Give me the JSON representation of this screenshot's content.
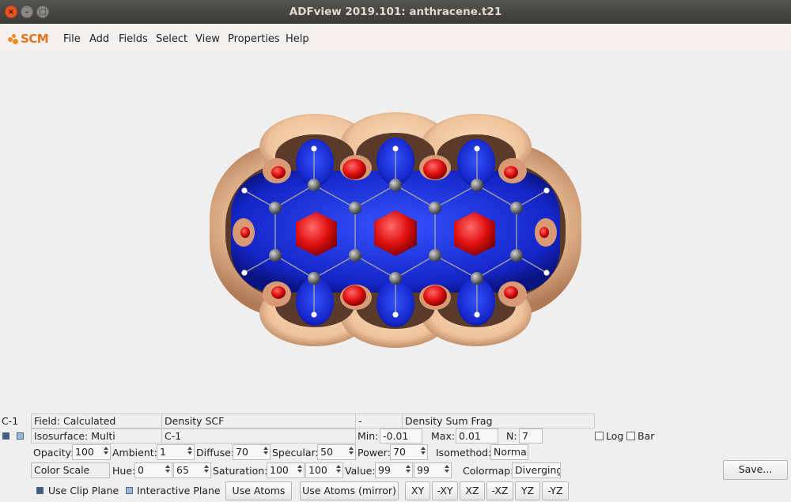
{
  "window": {
    "title": "ADFview 2019.101: anthracene.t21"
  },
  "logo": {
    "text": "SCM"
  },
  "menu": {
    "file": "File",
    "add": "Add",
    "fields": "Fields",
    "select": "Select",
    "view": "View",
    "properties": "Properties",
    "help": "Help"
  },
  "row1": {
    "id": "C-1",
    "field": "Field: Calculated",
    "density": "Density SCF",
    "dash": "-",
    "density_sum": "Density Sum Frag"
  },
  "row2": {
    "isosurface": "Isosurface: Multi",
    "atom": "C-1",
    "min_label": "Min:",
    "min_value": "-0.01",
    "max_label": "Max:",
    "max_value": "0.01",
    "n_label": "N:",
    "n_value": "7",
    "log_label": "Log",
    "bar_label": "Bar"
  },
  "row3": {
    "opacity_label": "Opacity:",
    "opacity": "100",
    "ambient_label": "Ambient:",
    "ambient": "1",
    "diffuse_label": "Diffuse:",
    "diffuse": "70",
    "specular_label": "Specular:",
    "specular": "50",
    "power_label": "Power:",
    "power": "70",
    "isomethod_label": "Isomethod:",
    "isomethod": "Normal"
  },
  "row4": {
    "color_scale": "Color Scale",
    "hue_label": "Hue:",
    "hue_1": "0",
    "hue_2": "65",
    "saturation_label": "Saturation:",
    "sat_1": "100",
    "sat_2": "100",
    "value_label": "Value:",
    "val_1": "99",
    "val_2": "99",
    "colormap_label": "Colormap:",
    "colormap": "Diverging",
    "save": "Save..."
  },
  "row5": {
    "use_clip_plane": "Use Clip Plane",
    "interactive_plane": "Interactive Plane",
    "use_atoms": "Use Atoms",
    "use_atoms_mirror": "Use Atoms (mirror)",
    "xy": "XY",
    "mxy": "-XY",
    "xz": "XZ",
    "mxz": "-XZ",
    "yz": "YZ",
    "myz": "-YZ"
  },
  "colors": {
    "accent": "#e8731a",
    "surface_outer": "#f0c8a4",
    "surface_inner": "#1a2fd0",
    "lobe": "#d81818",
    "atom_c": "#7a7a7a",
    "atom_h": "#ffffff"
  }
}
